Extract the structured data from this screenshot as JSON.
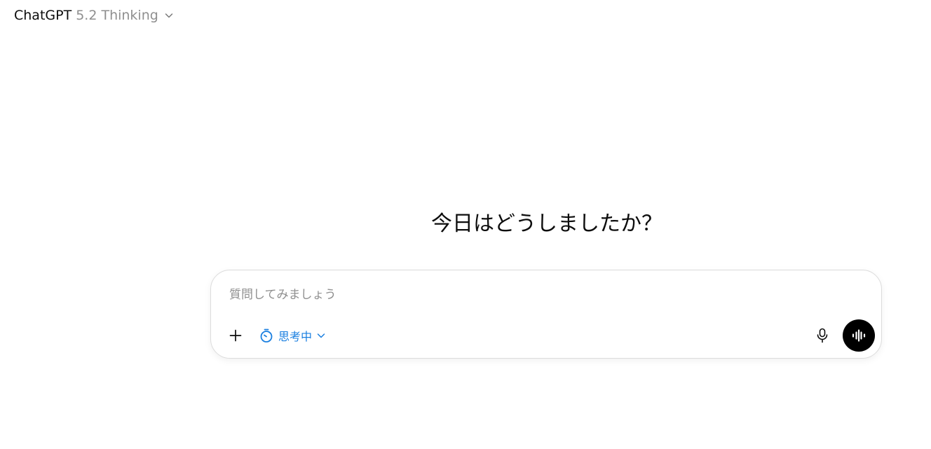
{
  "header": {
    "model_name": "ChatGPT",
    "model_version": "5.2 Thinking",
    "chevron_icon": "chevron-down-icon"
  },
  "main": {
    "greeting": "今日はどうしましたか？"
  },
  "composer": {
    "placeholder": "質問してみましょう",
    "value": "",
    "add_icon": "plus-icon",
    "thinking_icon": "stopwatch-icon",
    "thinking_label": "思考中",
    "thinking_chevron_icon": "chevron-down-icon",
    "mic_icon": "microphone-icon",
    "voice_icon": "voice-waveform-icon"
  },
  "colors": {
    "accent": "#1a7fe0",
    "muted_text": "#8f8f8f",
    "voice_button_bg": "#000000",
    "composer_border": "#dcdcdc"
  }
}
